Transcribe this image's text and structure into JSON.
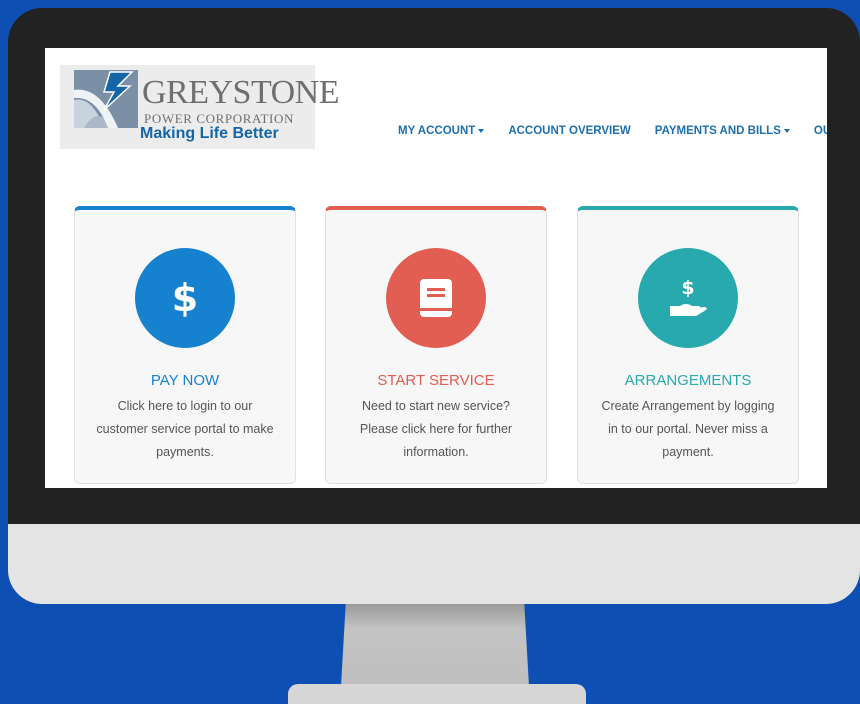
{
  "header": {
    "logo_name": "GREYSTONE",
    "logo_sub": "POWER CORPORATION",
    "logo_tagline": "Making Life Better"
  },
  "nav": [
    {
      "label": "MY ACCOUNT",
      "dropdown": true
    },
    {
      "label": "ACCOUNT OVERVIEW",
      "dropdown": false
    },
    {
      "label": "PAYMENTS AND BILLS",
      "dropdown": true
    },
    {
      "label": "OUR S",
      "dropdown": false
    }
  ],
  "cards": [
    {
      "title": "PAY NOW",
      "text": "Click here to login to our customer service portal to make payments.",
      "icon": "dollar-icon",
      "color": "#1682cf"
    },
    {
      "title": "START SERVICE",
      "text": "Need to start new service? Please click here for further information.",
      "icon": "book-icon",
      "color": "#e25e52"
    },
    {
      "title": "ARRANGEMENTS",
      "text": "Create Arrangement by logging in to our portal. Never miss a payment.",
      "icon": "hand-dollar-icon",
      "color": "#27a9ad"
    }
  ],
  "colors": {
    "background": "#0e4fb3",
    "nav_text": "#1d6fb0",
    "tagline": "#1466a8"
  }
}
